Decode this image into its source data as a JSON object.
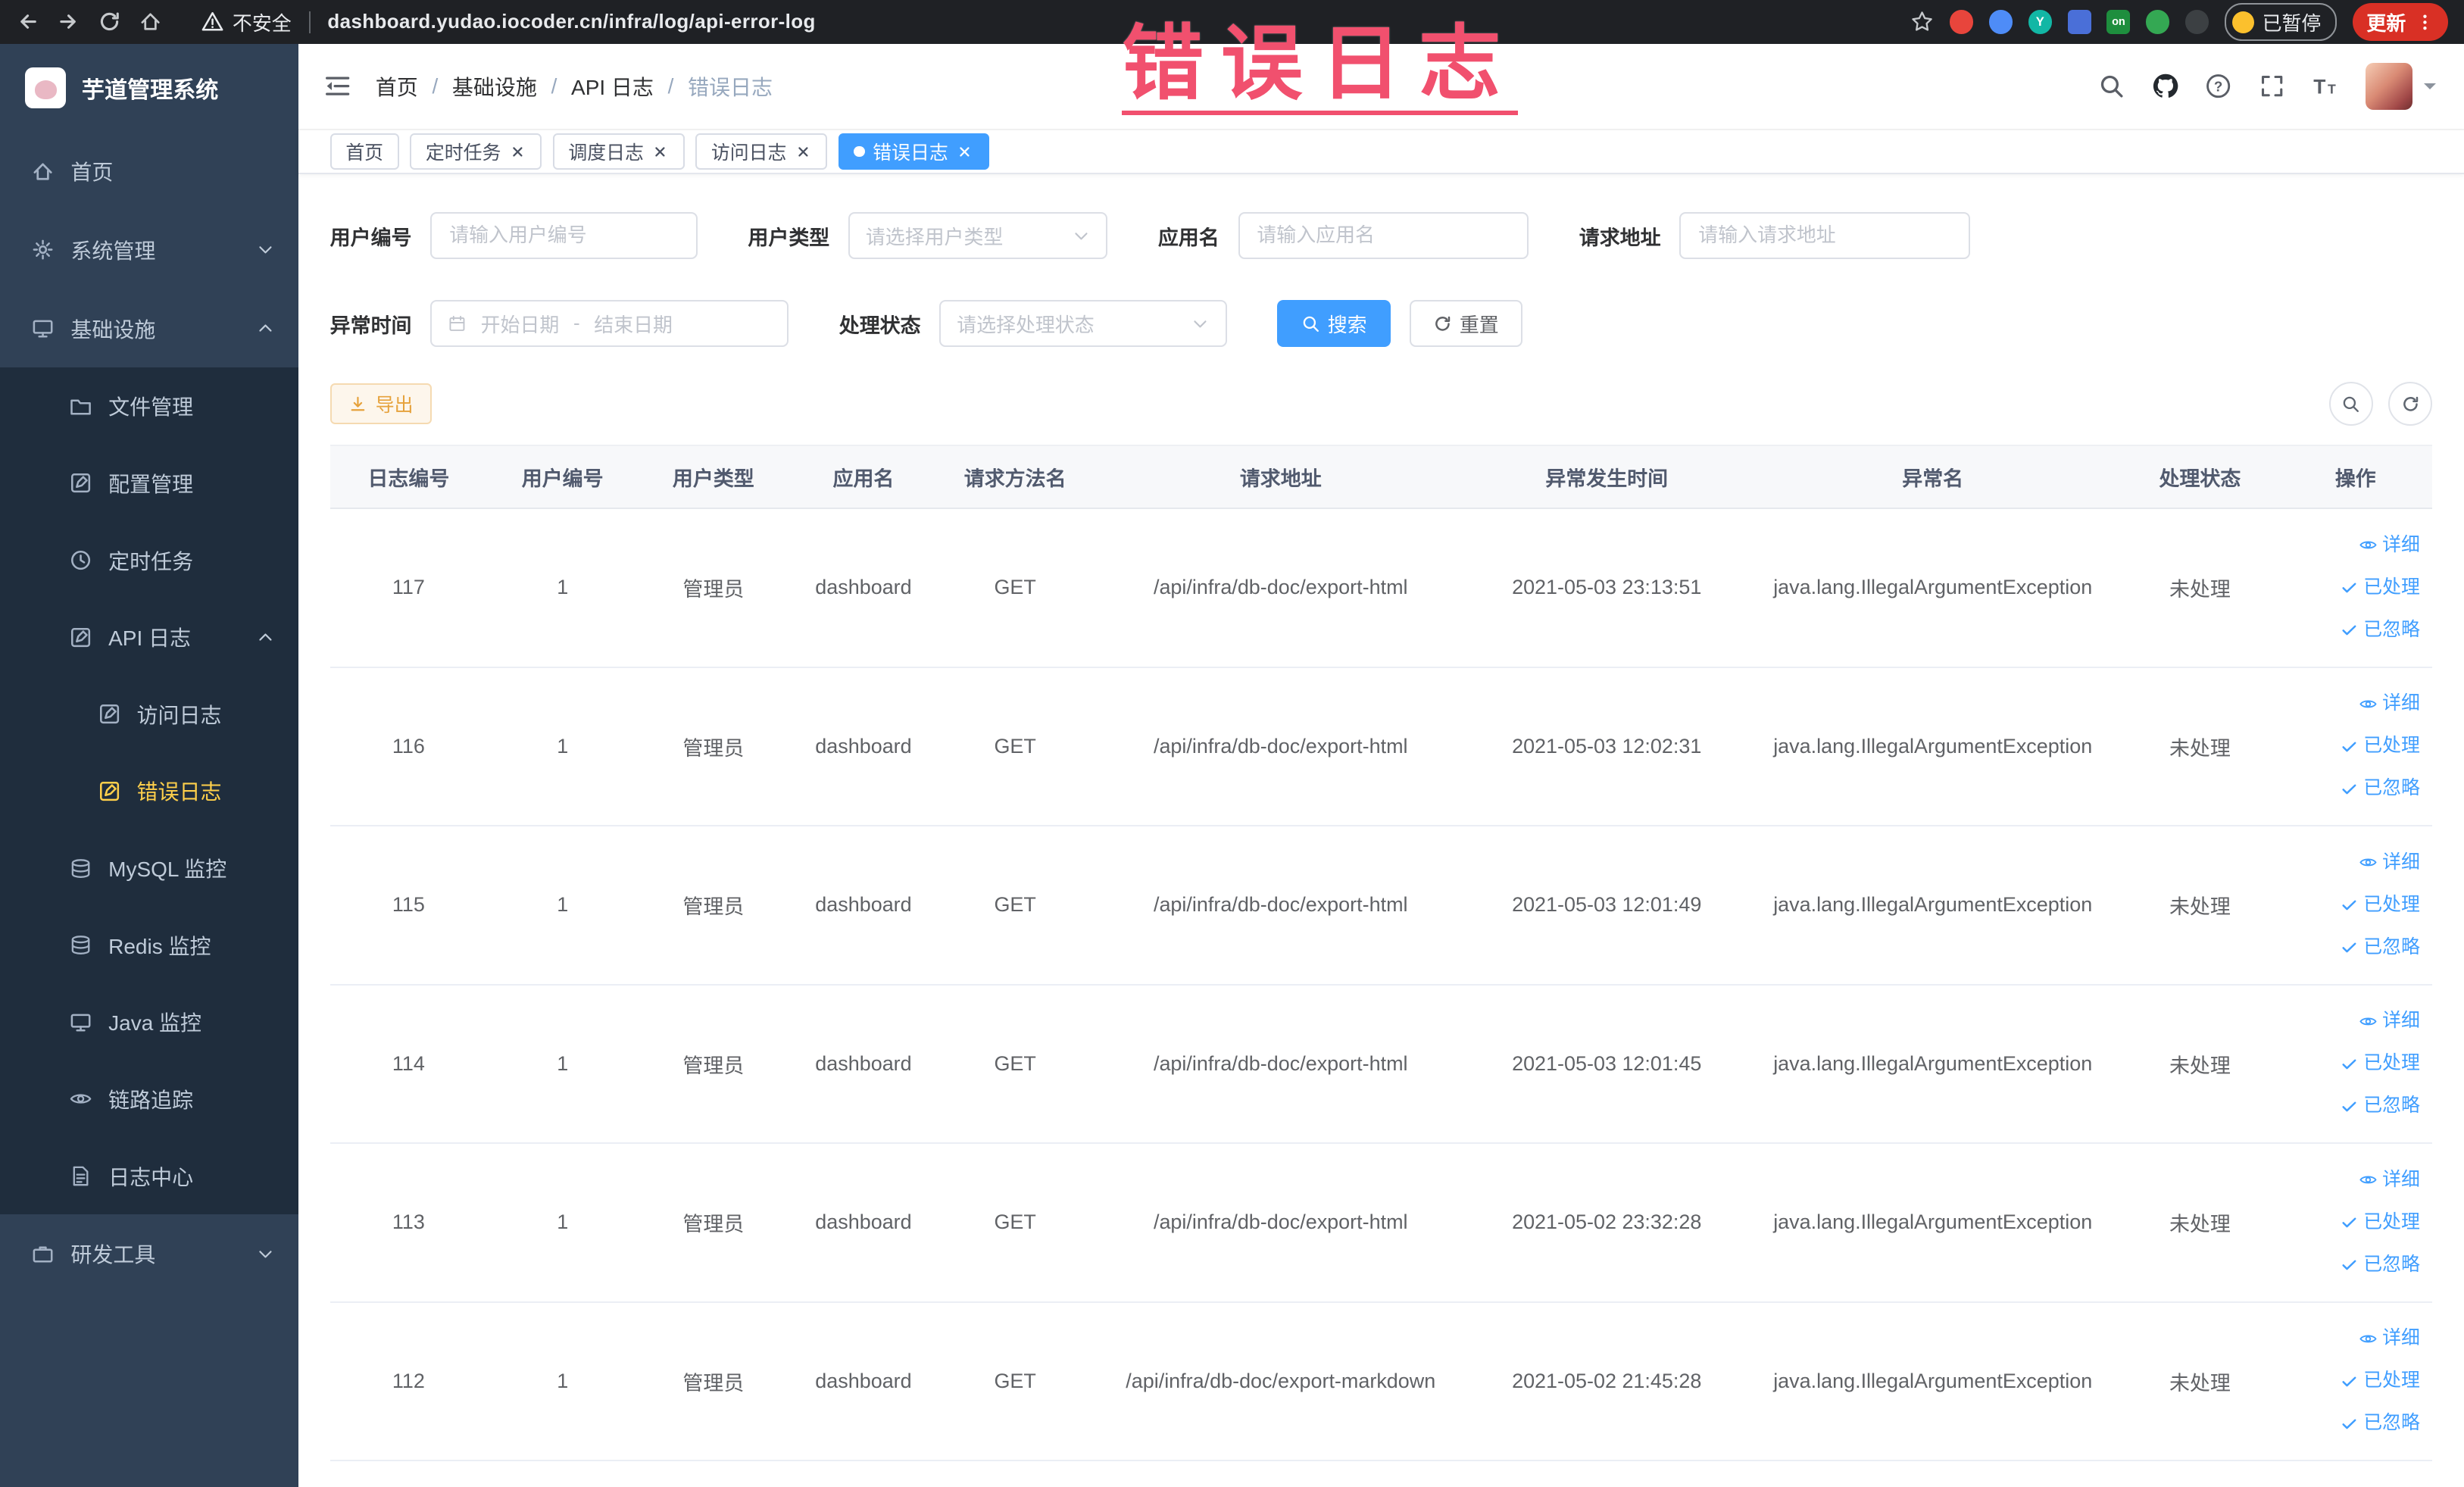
{
  "browser": {
    "security_label": "不安全",
    "url": "dashboard.yudao.iocoder.cn/infra/log/api-error-log",
    "extension_y_label": "Y",
    "extension_on_label": "on",
    "paused_badge": "已暂停",
    "update_button": "更新"
  },
  "annotation": {
    "text": "错误日志",
    "color": "#f1506e"
  },
  "sidebar": {
    "logo_title": "芋道管理系统",
    "items": [
      {
        "label": "首页"
      },
      {
        "label": "系统管理"
      },
      {
        "label": "基础设施"
      },
      {
        "label": "文件管理"
      },
      {
        "label": "配置管理"
      },
      {
        "label": "定时任务"
      },
      {
        "label": "API 日志"
      },
      {
        "label": "访问日志"
      },
      {
        "label": "错误日志"
      },
      {
        "label": "MySQL 监控"
      },
      {
        "label": "Redis 监控"
      },
      {
        "label": "Java 监控"
      },
      {
        "label": "链路追踪"
      },
      {
        "label": "日志中心"
      },
      {
        "label": "研发工具"
      }
    ]
  },
  "header": {
    "breadcrumb": [
      "首页",
      "基础设施",
      "API 日志",
      "错误日志"
    ]
  },
  "tabs": [
    {
      "label": "首页",
      "closable": false,
      "active": false
    },
    {
      "label": "定时任务",
      "closable": true,
      "active": false
    },
    {
      "label": "调度日志",
      "closable": true,
      "active": false
    },
    {
      "label": "访问日志",
      "closable": true,
      "active": false
    },
    {
      "label": "错误日志",
      "closable": true,
      "active": true
    }
  ],
  "filters": {
    "user_id": {
      "label": "用户编号",
      "placeholder": "请输入用户编号"
    },
    "user_type": {
      "label": "用户类型",
      "placeholder": "请选择用户类型"
    },
    "app_name": {
      "label": "应用名",
      "placeholder": "请输入应用名"
    },
    "request_url": {
      "label": "请求地址",
      "placeholder": "请输入请求地址"
    },
    "exception_time": {
      "label": "异常时间",
      "start_placeholder": "开始日期",
      "range_separator": "-",
      "end_placeholder": "结束日期"
    },
    "process_status": {
      "label": "处理状态",
      "placeholder": "请选择处理状态"
    },
    "search_button": "搜索",
    "reset_button": "重置"
  },
  "toolbar": {
    "export_button": "导出"
  },
  "table": {
    "columns": [
      "日志编号",
      "用户编号",
      "用户类型",
      "应用名",
      "请求方法名",
      "请求地址",
      "异常发生时间",
      "异常名",
      "处理状态",
      "操作"
    ],
    "row_actions": {
      "detail": "详细",
      "processed": "已处理",
      "ignored": "已忽略"
    },
    "rows": [
      {
        "id": "117",
        "user_id": "1",
        "user_type": "管理员",
        "app": "dashboard",
        "method": "GET",
        "url": "/api/infra/db-doc/export-html",
        "time": "2021-05-03 23:13:51",
        "exception": "java.lang.IllegalArgumentException",
        "status": "未处理"
      },
      {
        "id": "116",
        "user_id": "1",
        "user_type": "管理员",
        "app": "dashboard",
        "method": "GET",
        "url": "/api/infra/db-doc/export-html",
        "time": "2021-05-03 12:02:31",
        "exception": "java.lang.IllegalArgumentException",
        "status": "未处理"
      },
      {
        "id": "115",
        "user_id": "1",
        "user_type": "管理员",
        "app": "dashboard",
        "method": "GET",
        "url": "/api/infra/db-doc/export-html",
        "time": "2021-05-03 12:01:49",
        "exception": "java.lang.IllegalArgumentException",
        "status": "未处理"
      },
      {
        "id": "114",
        "user_id": "1",
        "user_type": "管理员",
        "app": "dashboard",
        "method": "GET",
        "url": "/api/infra/db-doc/export-html",
        "time": "2021-05-03 12:01:45",
        "exception": "java.lang.IllegalArgumentException",
        "status": "未处理"
      },
      {
        "id": "113",
        "user_id": "1",
        "user_type": "管理员",
        "app": "dashboard",
        "method": "GET",
        "url": "/api/infra/db-doc/export-html",
        "time": "2021-05-02 23:32:28",
        "exception": "java.lang.IllegalArgumentException",
        "status": "未处理"
      },
      {
        "id": "112",
        "user_id": "1",
        "user_type": "管理员",
        "app": "dashboard",
        "method": "GET",
        "url": "/api/infra/db-doc/export-markdown",
        "time": "2021-05-02 21:45:28",
        "exception": "java.lang.IllegalArgumentException",
        "status": "未处理"
      }
    ]
  },
  "colors": {
    "primary": "#409eff",
    "sidebar_bg": "#304156",
    "sidebar_submenu_bg": "#1f2d3d",
    "sidebar_active_text": "#ffd04b",
    "warning": "#e6a23c",
    "annotation": "#f1506e",
    "update_button_bg": "#d93025"
  }
}
